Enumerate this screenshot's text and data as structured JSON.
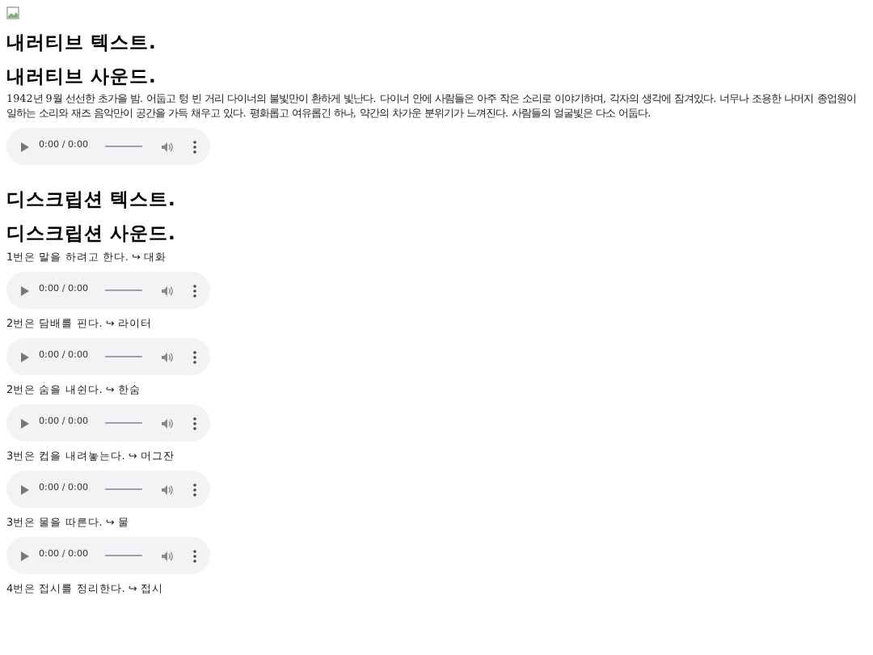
{
  "sections": [
    {
      "headings": [
        "내러티브 텍스트.",
        "내러티브 사운드."
      ],
      "paragraph": "1942년 9월 선선한 초가을 밤. 어둡고 텅 빈 거리 다이너의 불빛만이 환하게 빛난다. 다이너 안에 사람들은 아주 작은 소리로 이야기하며, 각자의 생각에 잠겨있다. 너무나 조용한 나머지 종업원이 일하는 소리와 재즈 음악만이 공간을 가득 채우고 있다. 평화롭고 여유롭긴 하나, 약간의 차가운 분위기가 느껴진다. 사람들의 얼굴빛은 다소 어둡다.",
      "items": [
        {
          "player": {
            "time": "0:00 / 0:00"
          }
        }
      ]
    },
    {
      "headings": [
        "디스크립션 텍스트.",
        "디스크립션 사운드."
      ],
      "items": [
        {
          "sentence": "1번은 말을 하려고 한다. ↪ 대화",
          "player": {
            "time": "0:00 / 0:00"
          }
        },
        {
          "sentence": "2번은 담배를 핀다. ↪ 라이터",
          "player": {
            "time": "0:00 / 0:00"
          }
        },
        {
          "sentence": "2번은 숨을 내쉰다. ↪ 한숨",
          "player": {
            "time": "0:00 / 0:00"
          }
        },
        {
          "sentence": "3번은 컵을 내려놓는다. ↪ 머그잔",
          "player": {
            "time": "0:00 / 0:00"
          }
        },
        {
          "sentence": "3번은 물을 따른다. ↪ 물",
          "player": {
            "time": "0:00 / 0:00"
          }
        },
        {
          "sentence": "4번은 접시를 정리한다. ↪ 접시"
        }
      ]
    }
  ]
}
